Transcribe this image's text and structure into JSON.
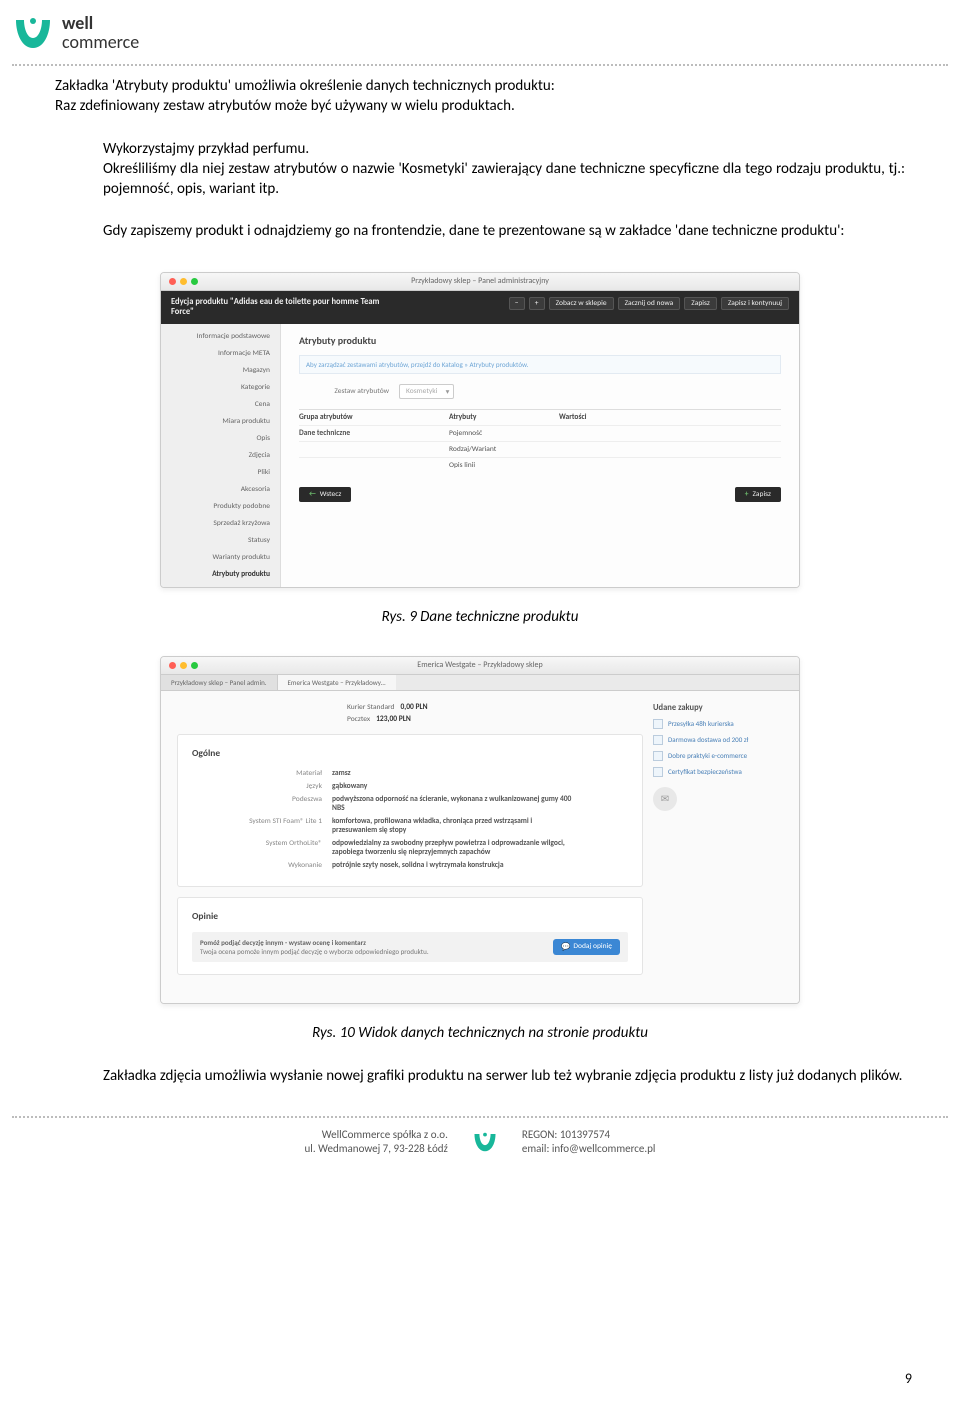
{
  "logo": {
    "line1": "well",
    "line2": "commerce"
  },
  "body": {
    "p1": "Zakładka 'Atrybuty produktu' umożliwia określenie danych technicznych produktu:",
    "p2": "Raz zdefiniowany zestaw atrybutów może być używany w wielu produktach.",
    "p3": "Wykorzystajmy przykład perfumu.",
    "p4": "Określiliśmy dla niej zestaw atrybutów o nazwie 'Kosmetyki' zawierający dane techniczne specyficzne dla tego rodzaju produktu, tj.: pojemność, opis, wariant itp.",
    "p5": "Gdy zapiszemy produkt i odnajdziemy go na frontendzie, dane te prezentowane są w zakładce 'dane techniczne produktu':",
    "caption1": "Rys. 9 Dane techniczne produktu",
    "caption2": "Rys. 10 Widok danych technicznych na stronie produktu",
    "p6": "Zakładka zdjęcia umożliwia wysłanie nowej grafiki produktu na serwer lub też wybranie zdjęcia produktu z listy już dodanych plików."
  },
  "admin": {
    "mac_title": "Przykładowy sklep – Panel administracyjny",
    "edit_title": "Edycja produktu \"Adidas eau de toilette pour homme Team Force\"",
    "actions": {
      "view": "Zobacz w sklepie",
      "new": "Zacznij od nowa",
      "save": "Zapisz",
      "save_cont": "Zapisz i kontynuuj"
    },
    "sidebar": [
      "Informacje podstawowe",
      "Informacje META",
      "Magazyn",
      "Kategorie",
      "Cena",
      "Miara produktu",
      "Opis",
      "Zdjęcia",
      "Pliki",
      "Akcesoria",
      "Produkty podobne",
      "Sprzedaż krzyżowa",
      "Statusy",
      "Warianty produktu",
      "Atrybuty produktu"
    ],
    "pane_title": "Atrybuty produktu",
    "hint": "Aby zarządzać zestawami atrybutów, przejdź do Katalog » Atrybuty produktów.",
    "select_label": "Zestaw atrybutów",
    "select_value": "Kosmetyki",
    "table": {
      "h1": "Grupa atrybutów",
      "h2": "Atrybuty",
      "h3": "Wartości",
      "group": "Dane techniczne",
      "a1": "Pojemność",
      "a2": "Rodzaj/Wariant",
      "a3": "Opis linii"
    },
    "btn_back": "Wstecz",
    "btn_save": "Zapisz"
  },
  "store": {
    "mac_title": "Emerica Westgate – Przykładowy sklep",
    "tabs": {
      "t1": "Przykładowy sklep – Panel admin.",
      "t2": "Emerica Westgate – Przykładowy..."
    },
    "ship": {
      "kurier_lbl": "Kurier Standard",
      "kurier_val": "0,00 PLN",
      "pocztex_lbl": "Pocztex",
      "pocztex_val": "123,00 PLN"
    },
    "side": {
      "title": "Udane zakupy",
      "items": [
        "Przesyłka 48h kurierska",
        "Darmowa dostawa od 200 zł",
        "Dobre praktyki e-commerce",
        "Certyfikat bezpieczeństwa"
      ]
    },
    "ogolne": {
      "title": "Ogólne",
      "rows": [
        {
          "label": "Materiał",
          "value": "zamsz"
        },
        {
          "label": "Język",
          "value": "gąbkowany"
        },
        {
          "label": "Podeszwa",
          "value": "podwyższona odporność na ścieranie, wykonana z wulkanizowanej gumy 400 NBS"
        },
        {
          "label": "System STI Foam® Lite 1",
          "value": "komfortowa, profilowana wkładka, chroniąca przed wstrząsami i przesuwaniem się stopy"
        },
        {
          "label": "System OrthoLite®",
          "value": "odpowiedzialny za swobodny przepływ powietrza i odprowadzanie wilgoci, zapobiega tworzeniu się nieprzyjemnych zapachów"
        },
        {
          "label": "Wykonanie",
          "value": "potrójnie szyty nosek, solidna i wytrzymała konstrukcja"
        }
      ]
    },
    "opinie": {
      "title": "Opinie",
      "line1": "Pomóż podjąć decyzję innym - wystaw ocenę i komentarz",
      "line2": "Twoja ocena pomoże innym podjąć decyzję o wyborze odpowiedniego produktu.",
      "btn": "Dodaj opinię"
    }
  },
  "footer": {
    "company": "WellCommerce spółka z o.o.",
    "address": "ul. Wedmanowej 7, 93-228 Łódź",
    "regon": "REGON: 101397574",
    "email": "email: info@wellcommerce.pl"
  },
  "page_number": "9"
}
